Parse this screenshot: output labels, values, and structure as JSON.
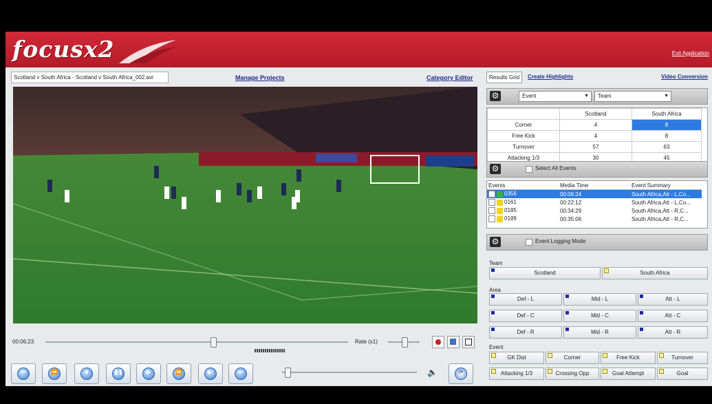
{
  "app": {
    "logo": "focusx2",
    "exit_label": "Exit Application"
  },
  "left": {
    "filename": "Scotland v South Africa - Scotland v South Africa_002.avi",
    "manage_projects": "Manage Projects",
    "category_editor": "Category Editor",
    "current_time": "00:06:23",
    "rate_label": "Rate (x1)"
  },
  "controls": [
    {
      "name": "skip-start",
      "glyph": "⏮"
    },
    {
      "name": "rewind",
      "glyph": "⏪"
    },
    {
      "name": "stop",
      "glyph": "■"
    },
    {
      "name": "pause",
      "glyph": "❚❚"
    },
    {
      "name": "play",
      "glyph": "▶"
    },
    {
      "name": "fast-forward",
      "glyph": "⏩"
    },
    {
      "name": "step-forward",
      "glyph": "▶|"
    },
    {
      "name": "skip-end",
      "glyph": "⏭"
    }
  ],
  "right": {
    "tabs": {
      "results_grid": "Results Grid",
      "create_highlights": "Create Highlights",
      "video_conversion": "Video Conversion"
    },
    "event_dropdown": "Event",
    "team_dropdown": "Team",
    "grid": {
      "headers": [
        "",
        "Scotland",
        "South Africa"
      ],
      "rows": [
        [
          "Corner",
          "4",
          "8"
        ],
        [
          "Free Kick",
          "4",
          "8"
        ],
        [
          "Turnover",
          "57",
          "63"
        ],
        [
          "Attacking 1/3",
          "30",
          "45"
        ]
      ]
    },
    "select_all": "Select All Events",
    "events": {
      "headers": [
        "Events",
        "Media Time",
        "Event Summary"
      ],
      "rows": [
        {
          "id": "0356",
          "time": "00:06:24",
          "summary": "South Africa,Att - L,Co...",
          "selected": true,
          "color": "#3fae3f"
        },
        {
          "id": "0161",
          "time": "00:22:12",
          "summary": "South Africa,Att - L,Co...",
          "selected": false,
          "color": "#f2d21b"
        },
        {
          "id": "0185",
          "time": "00:34:29",
          "summary": "South Africa,Att - R,C...",
          "selected": false,
          "color": "#f2d21b"
        },
        {
          "id": "0189",
          "time": "00:35:06",
          "summary": "South Africa,Att - R,C...",
          "selected": false,
          "color": "#f2d21b"
        }
      ]
    },
    "event_logging": "Event Logging Mode",
    "team_label": "Team",
    "teams": [
      "Scotland",
      "South Africa"
    ],
    "area_label": "Area",
    "areas": [
      "Def - L",
      "Mid - L",
      "Att - L",
      "Def - C",
      "Mid - C",
      "Att - C",
      "Def - R",
      "Mid - R",
      "Att - R"
    ],
    "event_label": "Event",
    "events_buttons": [
      "GK Dist",
      "Corner",
      "Free Kick",
      "Turnover",
      "Attacking 1/3",
      "Crossing Opp",
      "Goal Attempt",
      "Goal"
    ]
  },
  "colors": {
    "header_red": "#c4202f",
    "selection_blue": "#2d7be0",
    "link_blue": "#1b2f8a"
  }
}
